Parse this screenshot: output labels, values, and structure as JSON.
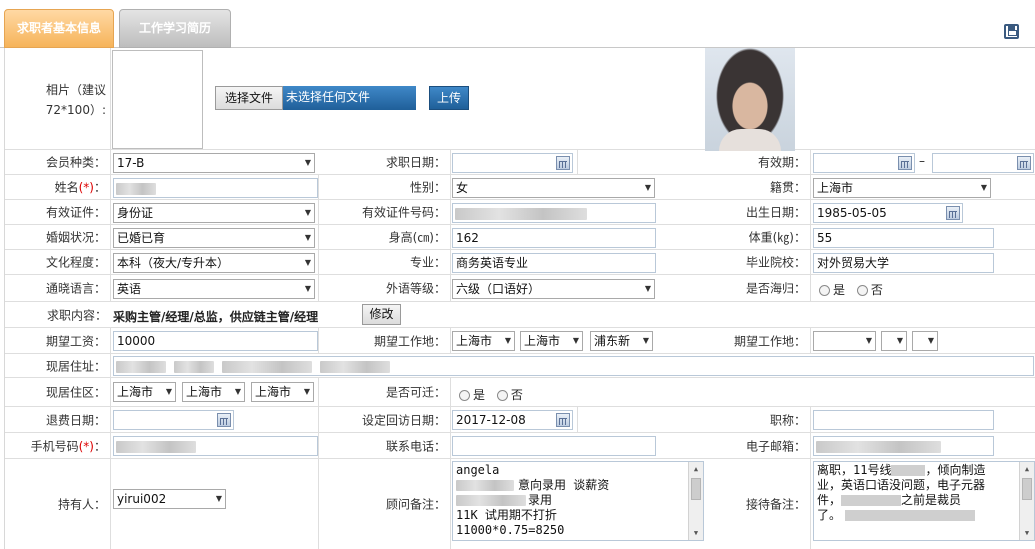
{
  "tabs": {
    "basic_info": "求职者基本信息",
    "work_study": "工作学习简历"
  },
  "photo": {
    "label_line1": "相片（建议",
    "label_line2": "72*100）:",
    "choose_file": "选择文件",
    "no_file": "未选择任何文件",
    "upload": "上传"
  },
  "fields": {
    "member_type_label": "会员种类：",
    "member_type_value": "17-B",
    "job_date_label": "求职日期：",
    "valid_period_label": "有效期：",
    "valid_period_sep": "–",
    "name_label": "姓名",
    "name_label_req": "(*)",
    "name_label_tail": "：",
    "gender_label": "性别：",
    "gender_value": "女",
    "native_label": "籍贯：",
    "native_value": "上海市",
    "id_type_label": "有效证件：",
    "id_type_value": "身份证",
    "id_number_label": "有效证件号码：",
    "birth_label": "出生日期：",
    "birth_value": "1985-05-05",
    "marital_label": "婚姻状况：",
    "marital_value": "已婚已育",
    "height_label": "身高(㎝)：",
    "height_value": "162",
    "weight_label": "体重(㎏)：",
    "weight_value": "55",
    "education_label": "文化程度：",
    "education_value": "本科（夜大/专升本）",
    "major_label": "专业：",
    "major_value": "商务英语专业",
    "school_label": "毕业院校：",
    "school_value": "对外贸易大学",
    "language_label": "通晓语言：",
    "language_value": "英语",
    "language_level_label": "外语等级：",
    "language_level_value": "六级（口语好）",
    "returnee_label": "是否海归：",
    "yes": "是",
    "no": "否",
    "job_content_label": "求职内容：",
    "job_content_value": "采购主管/经理/总监，供应链主管/经理",
    "modify": "修改",
    "salary_label": "期望工资：",
    "salary_value": "10000",
    "work_place_label": "期望工作地：",
    "work_place_1": "上海市",
    "work_place_2": "上海市",
    "work_place_3": "浦东新",
    "work_place2_label": "期望工作地：",
    "address_label": "现居住址：",
    "district_label": "现居住区：",
    "district_1": "上海市",
    "district_2": "上海市",
    "district_3": "上海市",
    "relocate_label": "是否可迁：",
    "refund_label": "退费日期：",
    "revisit_label": "设定回访日期：",
    "revisit_value": "2017-12-08",
    "title_label": "职称：",
    "mobile_label": "手机号码",
    "mobile_label_req": "(*)",
    "mobile_label_tail": "：",
    "phone_label": "联系电话：",
    "email_label": "电子邮箱：",
    "owner_label": "持有人：",
    "owner_value": "yirui002",
    "consultant_note_label": "顾问备注：",
    "consultant_note_lines": [
      "angela",
      "意向录用  谈薪资",
      "录用",
      "11K 试用期不打折",
      "11000*0.75=8250"
    ],
    "reception_note_label": "接待备注：",
    "reception_note_lines": [
      "离职，11号线",
      "，倾向制造",
      "业，英语口语没问题，电子元器",
      "件，",
      "之前是裁员",
      "了。"
    ]
  }
}
